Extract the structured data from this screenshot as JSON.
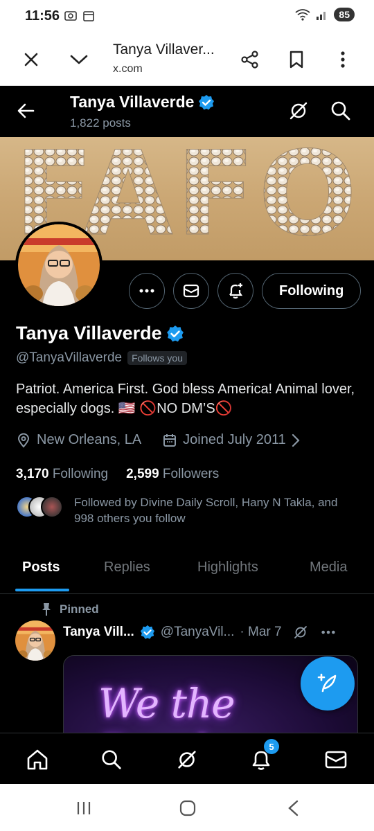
{
  "status_bar": {
    "time": "11:56",
    "battery": "85"
  },
  "browser": {
    "title": "Tanya Villaver...",
    "url": "x.com"
  },
  "header": {
    "name": "Tanya Villaverde",
    "post_count": "1,822 posts"
  },
  "banner": {
    "text": "FAFO"
  },
  "profile": {
    "name": "Tanya Villaverde",
    "handle": "@TanyaVillaverde",
    "follows_you": "Follows you",
    "bio": "Patriot. America First. God bless America! Animal lover, especially dogs. 🇺🇸 🚫NO DM’S🚫",
    "location": "New Orleans, LA",
    "joined": "Joined July 2011",
    "following_count": "3,170",
    "following_label": "Following",
    "followers_count": "2,599",
    "followers_label": "Followers",
    "followed_by": "Followed by Divine Daily Scroll, Hany N Takla, and 998 others you follow",
    "following_button": "Following"
  },
  "tabs": [
    "Posts",
    "Replies",
    "Highlights",
    "Media"
  ],
  "active_tab": "Posts",
  "pinned_post": {
    "pinned_label": "Pinned",
    "name": "Tanya Vill...",
    "handle": "@TanyaVil...",
    "date": "· Mar 7",
    "media_text": "We the People"
  },
  "bottom_nav": {
    "notification_badge": "5"
  },
  "colors": {
    "accent": "#1d9bf0",
    "background": "#000000",
    "secondary_text": "#8b98a5"
  }
}
